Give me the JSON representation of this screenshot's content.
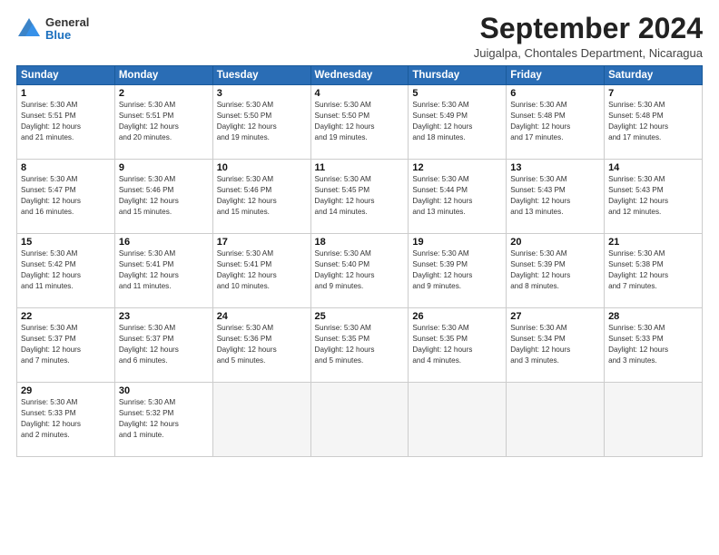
{
  "logo": {
    "general": "General",
    "blue": "Blue"
  },
  "title": "September 2024",
  "subtitle": "Juigalpa, Chontales Department, Nicaragua",
  "headers": [
    "Sunday",
    "Monday",
    "Tuesday",
    "Wednesday",
    "Thursday",
    "Friday",
    "Saturday"
  ],
  "weeks": [
    [
      {
        "day": "1",
        "info": "Sunrise: 5:30 AM\nSunset: 5:51 PM\nDaylight: 12 hours\nand 21 minutes."
      },
      {
        "day": "2",
        "info": "Sunrise: 5:30 AM\nSunset: 5:51 PM\nDaylight: 12 hours\nand 20 minutes."
      },
      {
        "day": "3",
        "info": "Sunrise: 5:30 AM\nSunset: 5:50 PM\nDaylight: 12 hours\nand 19 minutes."
      },
      {
        "day": "4",
        "info": "Sunrise: 5:30 AM\nSunset: 5:50 PM\nDaylight: 12 hours\nand 19 minutes."
      },
      {
        "day": "5",
        "info": "Sunrise: 5:30 AM\nSunset: 5:49 PM\nDaylight: 12 hours\nand 18 minutes."
      },
      {
        "day": "6",
        "info": "Sunrise: 5:30 AM\nSunset: 5:48 PM\nDaylight: 12 hours\nand 17 minutes."
      },
      {
        "day": "7",
        "info": "Sunrise: 5:30 AM\nSunset: 5:48 PM\nDaylight: 12 hours\nand 17 minutes."
      }
    ],
    [
      {
        "day": "8",
        "info": "Sunrise: 5:30 AM\nSunset: 5:47 PM\nDaylight: 12 hours\nand 16 minutes."
      },
      {
        "day": "9",
        "info": "Sunrise: 5:30 AM\nSunset: 5:46 PM\nDaylight: 12 hours\nand 15 minutes."
      },
      {
        "day": "10",
        "info": "Sunrise: 5:30 AM\nSunset: 5:46 PM\nDaylight: 12 hours\nand 15 minutes."
      },
      {
        "day": "11",
        "info": "Sunrise: 5:30 AM\nSunset: 5:45 PM\nDaylight: 12 hours\nand 14 minutes."
      },
      {
        "day": "12",
        "info": "Sunrise: 5:30 AM\nSunset: 5:44 PM\nDaylight: 12 hours\nand 13 minutes."
      },
      {
        "day": "13",
        "info": "Sunrise: 5:30 AM\nSunset: 5:43 PM\nDaylight: 12 hours\nand 13 minutes."
      },
      {
        "day": "14",
        "info": "Sunrise: 5:30 AM\nSunset: 5:43 PM\nDaylight: 12 hours\nand 12 minutes."
      }
    ],
    [
      {
        "day": "15",
        "info": "Sunrise: 5:30 AM\nSunset: 5:42 PM\nDaylight: 12 hours\nand 11 minutes."
      },
      {
        "day": "16",
        "info": "Sunrise: 5:30 AM\nSunset: 5:41 PM\nDaylight: 12 hours\nand 11 minutes."
      },
      {
        "day": "17",
        "info": "Sunrise: 5:30 AM\nSunset: 5:41 PM\nDaylight: 12 hours\nand 10 minutes."
      },
      {
        "day": "18",
        "info": "Sunrise: 5:30 AM\nSunset: 5:40 PM\nDaylight: 12 hours\nand 9 minutes."
      },
      {
        "day": "19",
        "info": "Sunrise: 5:30 AM\nSunset: 5:39 PM\nDaylight: 12 hours\nand 9 minutes."
      },
      {
        "day": "20",
        "info": "Sunrise: 5:30 AM\nSunset: 5:39 PM\nDaylight: 12 hours\nand 8 minutes."
      },
      {
        "day": "21",
        "info": "Sunrise: 5:30 AM\nSunset: 5:38 PM\nDaylight: 12 hours\nand 7 minutes."
      }
    ],
    [
      {
        "day": "22",
        "info": "Sunrise: 5:30 AM\nSunset: 5:37 PM\nDaylight: 12 hours\nand 7 minutes."
      },
      {
        "day": "23",
        "info": "Sunrise: 5:30 AM\nSunset: 5:37 PM\nDaylight: 12 hours\nand 6 minutes."
      },
      {
        "day": "24",
        "info": "Sunrise: 5:30 AM\nSunset: 5:36 PM\nDaylight: 12 hours\nand 5 minutes."
      },
      {
        "day": "25",
        "info": "Sunrise: 5:30 AM\nSunset: 5:35 PM\nDaylight: 12 hours\nand 5 minutes."
      },
      {
        "day": "26",
        "info": "Sunrise: 5:30 AM\nSunset: 5:35 PM\nDaylight: 12 hours\nand 4 minutes."
      },
      {
        "day": "27",
        "info": "Sunrise: 5:30 AM\nSunset: 5:34 PM\nDaylight: 12 hours\nand 3 minutes."
      },
      {
        "day": "28",
        "info": "Sunrise: 5:30 AM\nSunset: 5:33 PM\nDaylight: 12 hours\nand 3 minutes."
      }
    ],
    [
      {
        "day": "29",
        "info": "Sunrise: 5:30 AM\nSunset: 5:33 PM\nDaylight: 12 hours\nand 2 minutes."
      },
      {
        "day": "30",
        "info": "Sunrise: 5:30 AM\nSunset: 5:32 PM\nDaylight: 12 hours\nand 1 minute."
      },
      {
        "day": "",
        "info": ""
      },
      {
        "day": "",
        "info": ""
      },
      {
        "day": "",
        "info": ""
      },
      {
        "day": "",
        "info": ""
      },
      {
        "day": "",
        "info": ""
      }
    ]
  ]
}
